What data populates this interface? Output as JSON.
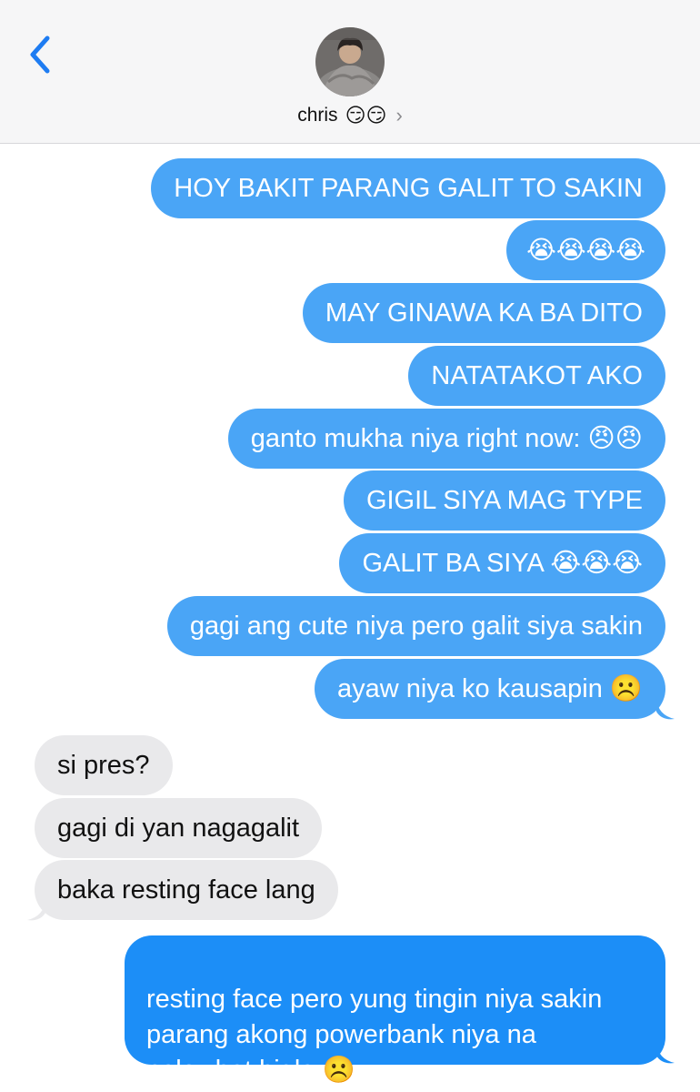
{
  "header": {
    "contact_name": "chris",
    "contact_emoji": "😏😏",
    "chevron": "›",
    "back_icon": "chevron-left-icon"
  },
  "messages": [
    {
      "side": "out",
      "text": "HOY BAKIT PARANG GALIT TO SAKIN"
    },
    {
      "side": "out",
      "text": "😭😭😭😭"
    },
    {
      "side": "out",
      "text": "MAY GINAWA KA BA DITO"
    },
    {
      "side": "out",
      "text": "NATATAKOT AKO"
    },
    {
      "side": "out",
      "text": "ganto mukha niya right now: 😠😠"
    },
    {
      "side": "out",
      "text": "GIGIL SIYA MAG TYPE"
    },
    {
      "side": "out",
      "text": "GALIT BA SIYA 😭😭😭"
    },
    {
      "side": "out",
      "text": "gagi ang cute niya pero galit siya sakin"
    },
    {
      "side": "out",
      "text": "ayaw niya ko kausapin ☹️"
    },
    {
      "side": "in",
      "text": "si pres?"
    },
    {
      "side": "in",
      "text": "gagi di yan nagagalit"
    },
    {
      "side": "in",
      "text": "baka resting face lang"
    },
    {
      "side": "out",
      "text": "resting face pero yung tingin niya sakin\nparang akong powerbank niya na\nnalowbat bigla ☹️"
    }
  ],
  "colors": {
    "outgoing_bubble": "#4aa5f6",
    "outgoing_last_bubble": "#1c8ef7",
    "incoming_bubble": "#e9e9eb",
    "header_bg": "#f6f6f7",
    "accent": "#1e7cf2"
  }
}
